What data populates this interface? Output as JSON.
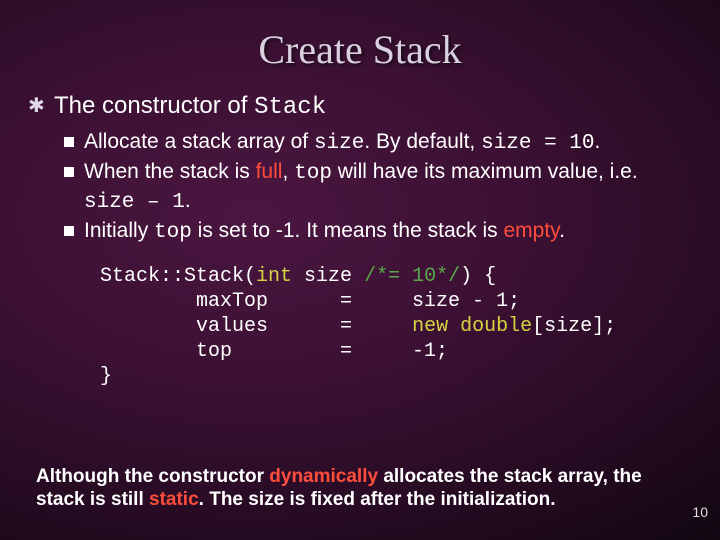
{
  "title": "Create Stack",
  "l1": {
    "pre": "The constructor of ",
    "code": "Stack"
  },
  "sub": [
    {
      "parts": [
        {
          "t": "Allocate a stack array of "
        },
        {
          "t": "size",
          "mono": true
        },
        {
          "t": ". By default, "
        },
        {
          "t": "size = 10",
          "mono": true
        },
        {
          "t": "."
        }
      ]
    },
    {
      "parts": [
        {
          "t": "When the stack is "
        },
        {
          "t": "full",
          "emph": true
        },
        {
          "t": ", "
        },
        {
          "t": "top",
          "mono": true
        },
        {
          "t": " will have its maximum value, i.e. "
        },
        {
          "t": "size – 1",
          "mono": true
        },
        {
          "t": "."
        }
      ]
    },
    {
      "parts": [
        {
          "t": "Initially "
        },
        {
          "t": "top",
          "mono": true
        },
        {
          "t": " is set to -1. It means the stack is "
        },
        {
          "t": "empty",
          "emph": true
        },
        {
          "t": "."
        }
      ]
    }
  ],
  "code": {
    "l1a": "Stack::Stack(",
    "l1b": "int",
    "l1c": " size ",
    "l1d": "/*= 10*/",
    "l1e": ") {",
    "l2": "        maxTop      =     size - 1;",
    "l3a": "        values      =     ",
    "l3b": "new",
    "l3c": " ",
    "l3d": "double",
    "l3e": "[size];",
    "l4": "        top         =     -1;",
    "l5": "}"
  },
  "footer": {
    "parts": [
      {
        "t": "Although the constructor "
      },
      {
        "t": "dynamically",
        "emph": true
      },
      {
        "t": " allocates the stack array, the stack is still "
      },
      {
        "t": "static",
        "emph": true
      },
      {
        "t": ". The size is fixed after the initialization."
      }
    ]
  },
  "pagenum": "10"
}
